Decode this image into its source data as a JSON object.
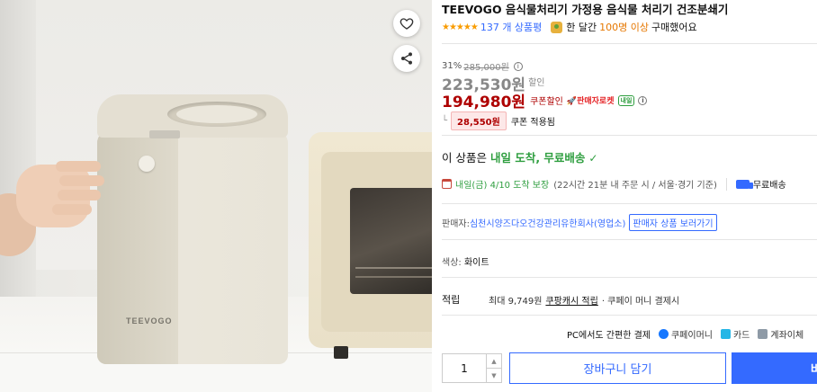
{
  "product": {
    "title": "TEEVOGO 음식물처리기 가정용 음식물 처리기 건조분쇄기",
    "brand_on_image": "TEEVOGO",
    "stars": "★★★★★",
    "review_count": "137 개 상품평",
    "purchase_pre": "한 달간",
    "purchase_count": "100명 이상",
    "purchase_post": "구매했어요"
  },
  "price": {
    "discount_pct": "31%",
    "original": "285,000원",
    "sale": "223,530원",
    "sale_label": "할인",
    "coupon_price": "194,980원",
    "coupon_label": "쿠폰할인",
    "rocket_seller": "🚀판매자로켓",
    "tomorrow_badge": "내일",
    "coupon_amount": "28,550원",
    "coupon_applied": "쿠폰 적용됨",
    "info_glyph": "i"
  },
  "delivery": {
    "head_pre": "이 상품은",
    "head_green": "내일 도착, 무료배송",
    "check": "✓",
    "arrival": "내일(금) 4/10 도착 보장",
    "arrival_note": "(22시간 21분 내 주문 시 / 서울·경기 기준)",
    "free_shipping": "무료배송"
  },
  "seller": {
    "label": "판매자:",
    "name": "심천시양즈다오건강관리유한회사(영업소)",
    "more_button": "판매자 상품 보러가기"
  },
  "option": {
    "color_label": "색상:",
    "color_value": "화이트"
  },
  "earn": {
    "title": "적립",
    "text": "최대 9,749원",
    "link": "쿠팡캐시 적립",
    "suffix": "· 쿠페이 머니 결제시"
  },
  "payment": {
    "label": "PC에서도 간편한 결제",
    "methods": [
      "쿠페이머니",
      "카드",
      "계좌이체"
    ]
  },
  "purchase": {
    "quantity": "1",
    "up": "▲",
    "down": "▼",
    "cart_label": "장바구니 담기",
    "buy_label": "바"
  },
  "colors": {
    "accent": "#346aff",
    "price_red": "#ae0000",
    "green": "#2e9e3f",
    "star": "#f99c00"
  },
  "icons": {
    "wishlist": "heart-icon",
    "share": "share-icon"
  }
}
